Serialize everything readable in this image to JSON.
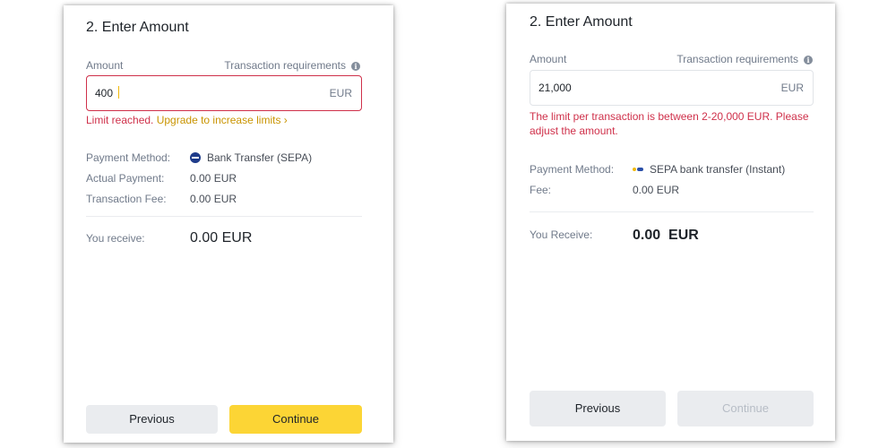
{
  "left": {
    "title": "2. Enter Amount",
    "amount_label": "Amount",
    "requirements_label": "Transaction requirements",
    "info_glyph": "i",
    "amount_value": "400",
    "currency": "EUR",
    "error_text": "Limit reached.",
    "upgrade_link": "Upgrade to increase limits ›",
    "payment_method_label": "Payment Method:",
    "payment_method_value": "Bank Transfer (SEPA)",
    "actual_payment_label": "Actual Payment:",
    "actual_payment_value": "0.00 EUR",
    "fee_label": "Transaction Fee:",
    "fee_value": "0.00 EUR",
    "receive_label": "You receive:",
    "receive_value": "0.00 EUR",
    "previous_label": "Previous",
    "continue_label": "Continue"
  },
  "right": {
    "title": "2. Enter Amount",
    "amount_label": "Amount",
    "requirements_label": "Transaction requirements",
    "info_glyph": "i",
    "amount_value": "21,000",
    "currency": "EUR",
    "error_text_line1": "The limit per transaction is between 2-20,000 EUR. Please",
    "error_text_line2": "adjust the amount.",
    "payment_method_label": "Payment Method:",
    "payment_method_value": "SEPA bank transfer (Instant)",
    "fee_label": "Fee:",
    "fee_value": "0.00 EUR",
    "receive_label": "You Receive:",
    "receive_value": "0.00  EUR",
    "previous_label": "Previous",
    "continue_label": "Continue"
  },
  "colors": {
    "error": "#cf304a",
    "link": "#c99400",
    "primary_button": "#fcd535",
    "secondary_button": "#eaecef",
    "caret": "#f0b90b"
  },
  "icons": {
    "info": "info-icon",
    "sepa": "sepa-icon",
    "instant": "sepa-instant-icon"
  }
}
